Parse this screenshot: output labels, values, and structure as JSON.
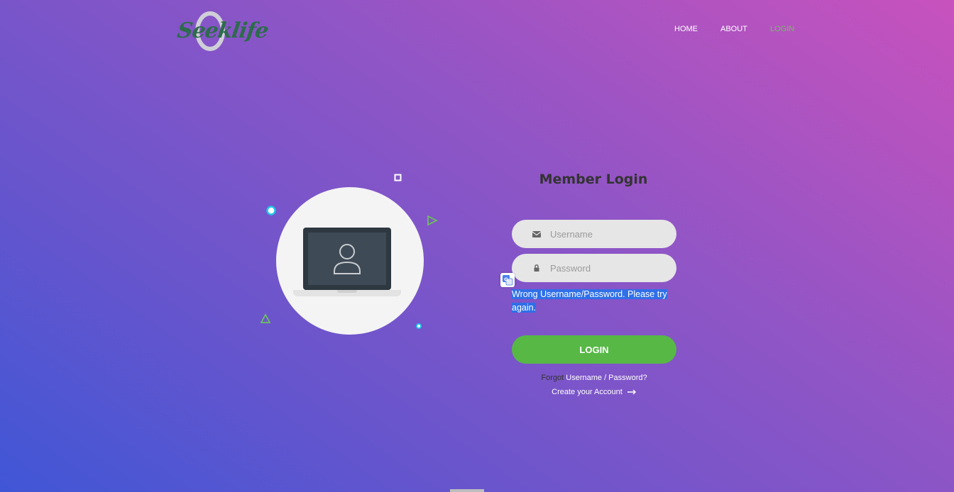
{
  "brand": {
    "name": "Seeklife"
  },
  "nav": {
    "items": [
      {
        "label": "HOME"
      },
      {
        "label": "ABOUT"
      },
      {
        "label": "LOGIN"
      }
    ],
    "active_color": "#6fbf5e"
  },
  "login": {
    "title": "Member Login",
    "username_placeholder": "Username",
    "password_placeholder": "Password",
    "error_message": "Wrong Username/Password. Please try again.",
    "login_label": "LOGIN",
    "forgot_prefix": "Forgot",
    "forgot_suffix": "Username / Password?",
    "create_account_label": "Create your Account"
  },
  "icons": {
    "username": "envelope-icon",
    "password": "lock-icon",
    "arrow": "arrow-right-icon",
    "translate": "translate-icon"
  },
  "colors": {
    "button": "#57b846",
    "error_highlight": "#2f6fe8",
    "title": "#333333"
  }
}
